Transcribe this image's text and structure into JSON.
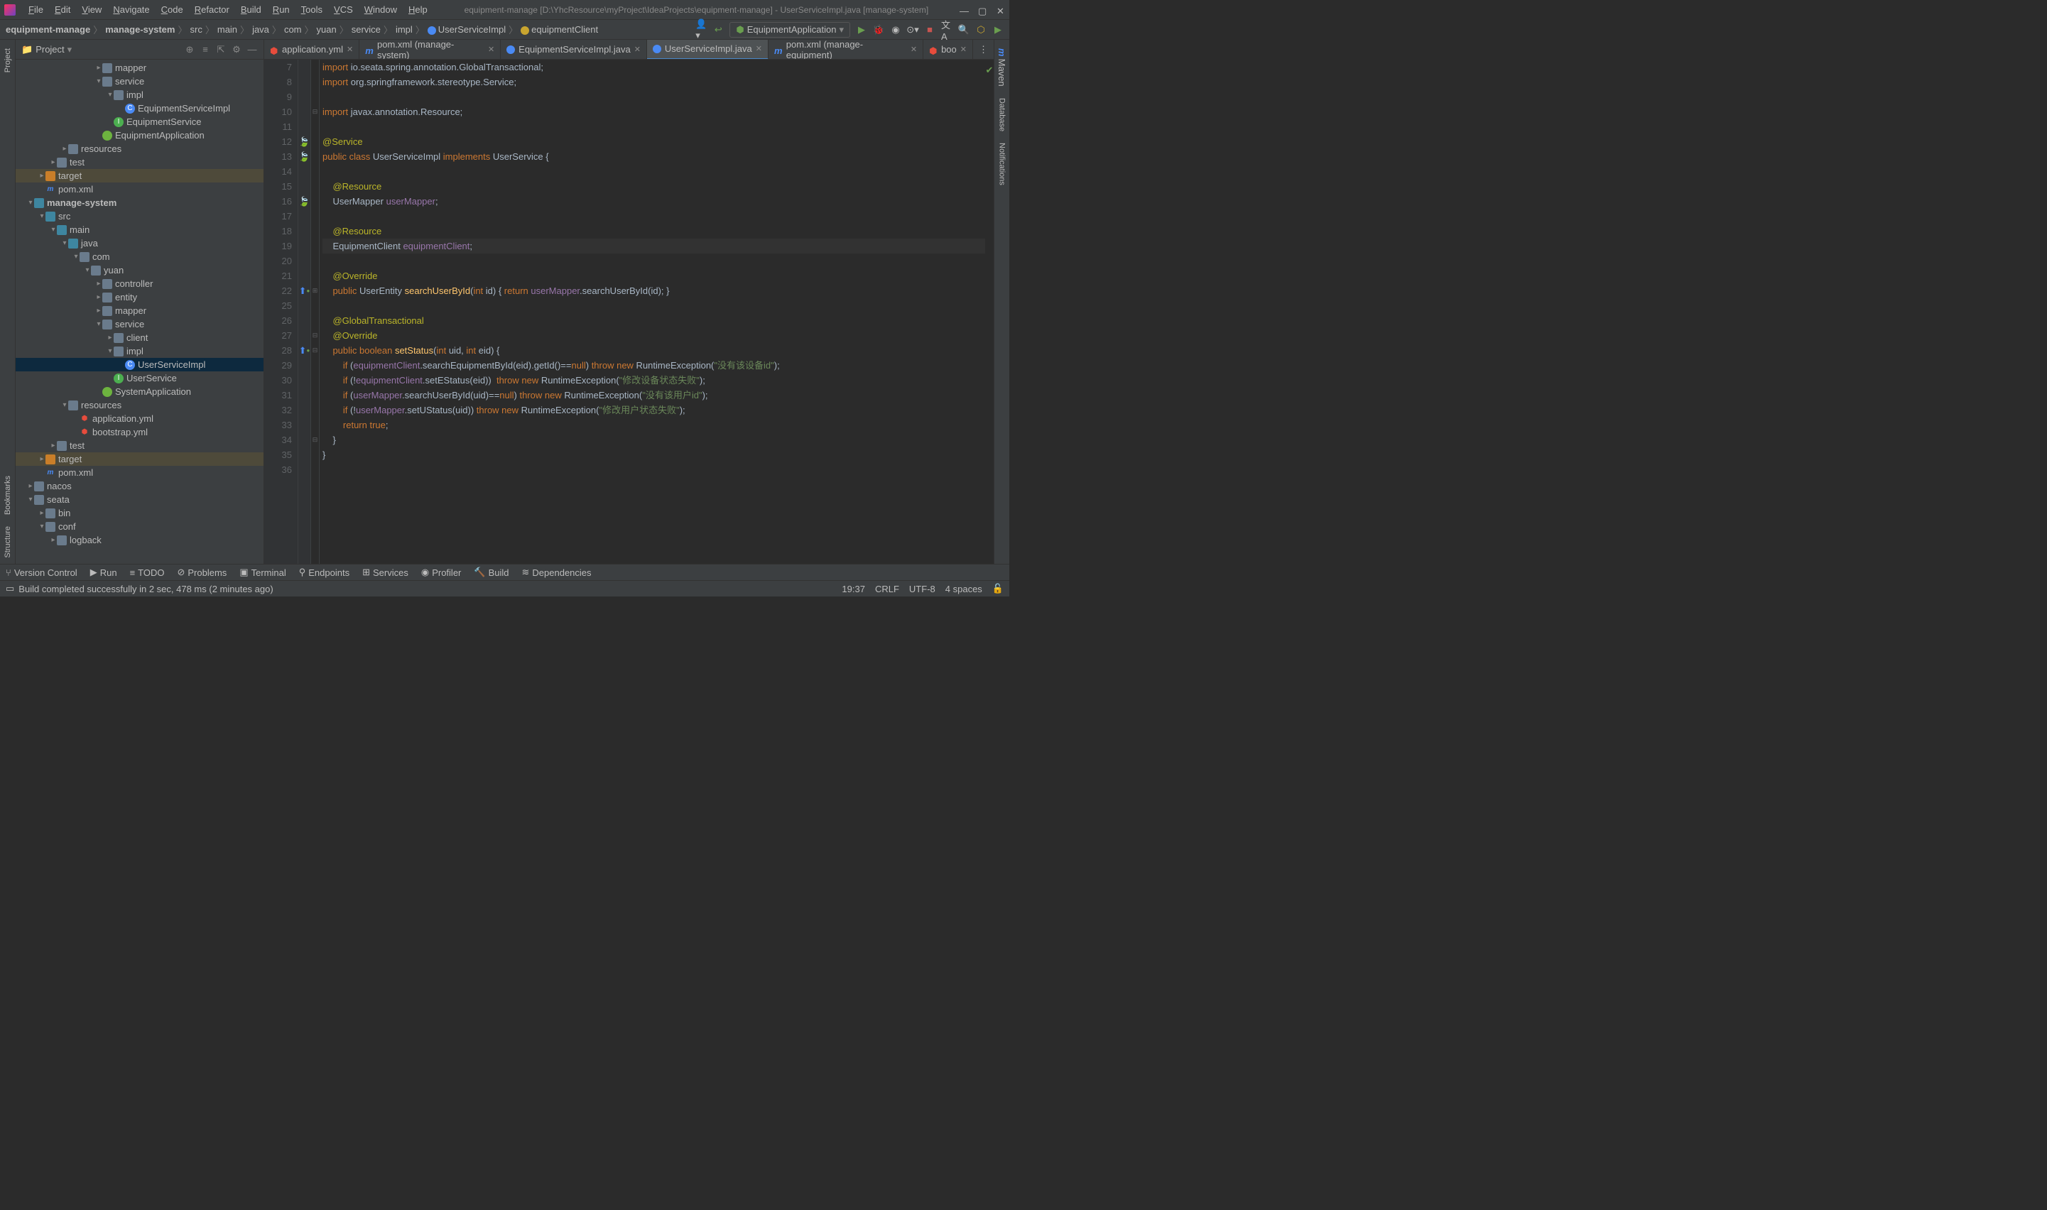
{
  "menu": [
    "File",
    "Edit",
    "View",
    "Navigate",
    "Code",
    "Refactor",
    "Build",
    "Run",
    "Tools",
    "VCS",
    "Window",
    "Help"
  ],
  "window_title": "equipment-manage [D:\\YhcResource\\myProject\\IdeaProjects\\equipment-manage] - UserServiceImpl.java [manage-system]",
  "breadcrumb": [
    "equipment-manage",
    "manage-system",
    "src",
    "main",
    "java",
    "com",
    "yuan",
    "service",
    "impl",
    "UserServiceImpl",
    "equipmentClient"
  ],
  "run_config": "EquipmentApplication",
  "sidebar_title": "Project",
  "tree": [
    {
      "depth": 7,
      "arrow": "closed",
      "icon": "folder",
      "label": "mapper"
    },
    {
      "depth": 7,
      "arrow": "open",
      "icon": "folder",
      "label": "service"
    },
    {
      "depth": 8,
      "arrow": "open",
      "icon": "folder",
      "label": "impl"
    },
    {
      "depth": 9,
      "arrow": "",
      "icon": "class",
      "label": "EquipmentServiceImpl"
    },
    {
      "depth": 8,
      "arrow": "",
      "icon": "interface",
      "label": "EquipmentService"
    },
    {
      "depth": 7,
      "arrow": "",
      "icon": "spring",
      "label": "EquipmentApplication"
    },
    {
      "depth": 4,
      "arrow": "closed",
      "icon": "folder-res",
      "label": "resources"
    },
    {
      "depth": 3,
      "arrow": "closed",
      "icon": "folder",
      "label": "test"
    },
    {
      "depth": 2,
      "arrow": "closed",
      "icon": "folder-orange",
      "label": "target",
      "highlighted": true
    },
    {
      "depth": 2,
      "arrow": "",
      "icon": "xml",
      "label": "pom.xml"
    },
    {
      "depth": 1,
      "arrow": "open",
      "icon": "folder-blue",
      "label": "manage-system",
      "bold": true
    },
    {
      "depth": 2,
      "arrow": "open",
      "icon": "folder-blue",
      "label": "src"
    },
    {
      "depth": 3,
      "arrow": "open",
      "icon": "folder-blue",
      "label": "main"
    },
    {
      "depth": 4,
      "arrow": "open",
      "icon": "folder-blue",
      "label": "java"
    },
    {
      "depth": 5,
      "arrow": "open",
      "icon": "folder",
      "label": "com"
    },
    {
      "depth": 6,
      "arrow": "open",
      "icon": "folder",
      "label": "yuan"
    },
    {
      "depth": 7,
      "arrow": "closed",
      "icon": "folder",
      "label": "controller"
    },
    {
      "depth": 7,
      "arrow": "closed",
      "icon": "folder",
      "label": "entity"
    },
    {
      "depth": 7,
      "arrow": "closed",
      "icon": "folder",
      "label": "mapper"
    },
    {
      "depth": 7,
      "arrow": "open",
      "icon": "folder",
      "label": "service"
    },
    {
      "depth": 8,
      "arrow": "closed",
      "icon": "folder",
      "label": "client"
    },
    {
      "depth": 8,
      "arrow": "open",
      "icon": "folder",
      "label": "impl"
    },
    {
      "depth": 9,
      "arrow": "",
      "icon": "class",
      "label": "UserServiceImpl",
      "selected": true
    },
    {
      "depth": 8,
      "arrow": "",
      "icon": "interface",
      "label": "UserService"
    },
    {
      "depth": 7,
      "arrow": "",
      "icon": "spring",
      "label": "SystemApplication"
    },
    {
      "depth": 4,
      "arrow": "open",
      "icon": "folder-res",
      "label": "resources"
    },
    {
      "depth": 5,
      "arrow": "",
      "icon": "yml",
      "label": "application.yml"
    },
    {
      "depth": 5,
      "arrow": "",
      "icon": "yml",
      "label": "bootstrap.yml"
    },
    {
      "depth": 3,
      "arrow": "closed",
      "icon": "folder",
      "label": "test"
    },
    {
      "depth": 2,
      "arrow": "closed",
      "icon": "folder-orange",
      "label": "target",
      "highlighted": true
    },
    {
      "depth": 2,
      "arrow": "",
      "icon": "xml",
      "label": "pom.xml"
    },
    {
      "depth": 1,
      "arrow": "closed",
      "icon": "folder",
      "label": "nacos"
    },
    {
      "depth": 1,
      "arrow": "open",
      "icon": "folder",
      "label": "seata"
    },
    {
      "depth": 2,
      "arrow": "closed",
      "icon": "folder",
      "label": "bin"
    },
    {
      "depth": 2,
      "arrow": "open",
      "icon": "folder",
      "label": "conf"
    },
    {
      "depth": 3,
      "arrow": "closed",
      "icon": "folder",
      "label": "logback"
    }
  ],
  "tabs": [
    {
      "label": "application.yml",
      "icon": "yml"
    },
    {
      "label": "pom.xml (manage-system)",
      "icon": "xml"
    },
    {
      "label": "EquipmentServiceImpl.java",
      "icon": "class"
    },
    {
      "label": "UserServiceImpl.java",
      "icon": "class",
      "active": true
    },
    {
      "label": "pom.xml (manage-equipment)",
      "icon": "xml"
    },
    {
      "label": "boo",
      "icon": "yml"
    }
  ],
  "gutter_start": 7,
  "gutter_end": 36,
  "gutter_icons": {
    "12": "leaf",
    "13": "leaf",
    "16": "leaf",
    "22": "ovr-up",
    "28": "ovr-up"
  },
  "fold_marks": {
    "10": "-",
    "22": "+",
    "27": "-",
    "28": "-",
    "34": "-"
  },
  "code_lines": [
    {
      "n": 7,
      "html": "<span class='kw'>import</span> io.seata.spring.annotation.<span class='cls'>GlobalTransactional</span>;"
    },
    {
      "n": 8,
      "html": "<span class='kw'>import</span> org.springframework.stereotype.<span class='cls'>Service</span>;"
    },
    {
      "n": 9,
      "html": ""
    },
    {
      "n": 10,
      "html": "<span class='kw'>import</span> javax.annotation.<span class='cls'>Resource</span>;"
    },
    {
      "n": 11,
      "html": ""
    },
    {
      "n": 12,
      "html": "<span class='ann'>@Service</span>"
    },
    {
      "n": 13,
      "html": "<span class='kw'>public class</span> UserServiceImpl <span class='kw'>implements</span> UserService {"
    },
    {
      "n": 14,
      "html": ""
    },
    {
      "n": 15,
      "html": "    <span class='ann'>@Resource</span>"
    },
    {
      "n": 16,
      "html": "    UserMapper <span class='field'>userMapper</span>;"
    },
    {
      "n": 17,
      "html": ""
    },
    {
      "n": 18,
      "html": "    <span class='ann'>@Resource</span>"
    },
    {
      "n": 19,
      "html": "    EquipmentClient <span class='field'>equipmentClient</span>;",
      "current": true
    },
    {
      "n": 20,
      "html": ""
    },
    {
      "n": 21,
      "html": "    <span class='ann'>@Override</span>"
    },
    {
      "n": 22,
      "html": "    <span class='kw'>public</span> UserEntity <span class='method'>searchUserById</span>(<span class='kw'>int</span> id) { <span class='kw'>return</span> <span class='field'>userMapper</span>.searchUserById(id); }"
    },
    {
      "n": 25,
      "html": ""
    },
    {
      "n": 26,
      "html": "    <span class='ann'>@GlobalTransactional</span>"
    },
    {
      "n": 27,
      "html": "    <span class='ann'>@Override</span>"
    },
    {
      "n": 28,
      "html": "    <span class='kw'>public boolean</span> <span class='method'>setStatus</span>(<span class='kw'>int</span> uid, <span class='kw'>int</span> eid) {"
    },
    {
      "n": 29,
      "html": "        <span class='kw'>if</span> (<span class='field'>equipmentClient</span>.searchEquipmentById(eid).getId()==<span class='kw'>null</span>) <span class='kw'>throw new</span> RuntimeException(<span class='str'>\"没有该设备id\"</span>);"
    },
    {
      "n": 30,
      "html": "        <span class='kw'>if</span> (!<span class='field'>equipmentClient</span>.setEStatus(eid))  <span class='kw'>throw new</span> RuntimeException(<span class='str'>\"修改设备状态失败\"</span>);"
    },
    {
      "n": 31,
      "html": "        <span class='kw'>if</span> (<span class='field'>userMapper</span>.searchUserById(uid)==<span class='kw'>null</span>) <span class='kw'>throw new</span> RuntimeException(<span class='str'>\"没有该用户id\"</span>);"
    },
    {
      "n": 32,
      "html": "        <span class='kw'>if</span> (!<span class='field'>userMapper</span>.setUStatus(uid)) <span class='kw'>throw new</span> RuntimeException(<span class='str'>\"修改用户状态失败\"</span>);"
    },
    {
      "n": 33,
      "html": "        <span class='kw'>return true</span>;"
    },
    {
      "n": 34,
      "html": "    }"
    },
    {
      "n": 35,
      "html": "}"
    },
    {
      "n": 36,
      "html": ""
    }
  ],
  "left_tool_tabs": [
    "Project",
    "Bookmarks",
    "Structure"
  ],
  "right_tool_tabs": [
    "Maven",
    "Database",
    "Notifications"
  ],
  "bottom_tabs": [
    "Version Control",
    "Run",
    "TODO",
    "Problems",
    "Terminal",
    "Endpoints",
    "Services",
    "Profiler",
    "Build",
    "Dependencies"
  ],
  "status_message": "Build completed successfully in 2 sec, 478 ms (2 minutes ago)",
  "status_right": {
    "pos": "19:37",
    "eol": "CRLF",
    "enc": "UTF-8",
    "indent": "4 spaces"
  }
}
